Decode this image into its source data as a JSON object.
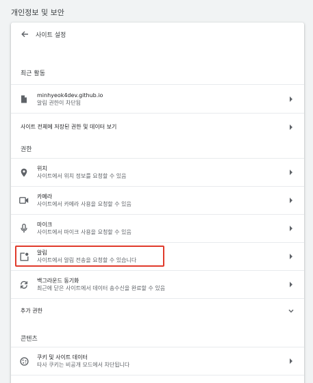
{
  "page": {
    "section_title": "개인정보 및 보안",
    "header_title": "사이트 설정"
  },
  "recent": {
    "label": "최근 활동",
    "site": {
      "domain": "minhyeok4dev.github.io",
      "status": "알림 권한이 차단됨"
    }
  },
  "all_sites": {
    "label": "사이트 전체에 저장된 권한 및 데이터 보기"
  },
  "permissions": {
    "label": "권한",
    "items": [
      {
        "icon": "location-pin-icon",
        "title": "위치",
        "desc": "사이트에서 위치 정보를 요청할 수 있음"
      },
      {
        "icon": "camera-icon",
        "title": "카메라",
        "desc": "사이트에서 카메라 사용을 요청할 수 있음"
      },
      {
        "icon": "microphone-icon",
        "title": "마이크",
        "desc": "사이트에서 마이크 사용을 요청할 수 있음"
      },
      {
        "icon": "notification-icon",
        "title": "알림",
        "desc": "사이트에서 알림 전송을 요청할 수 있습니다"
      },
      {
        "icon": "sync-icon",
        "title": "백그라운드 동기화",
        "desc": "최근에 닫은 사이트에서 데이터 송수신을 완료할 수 있음"
      }
    ]
  },
  "additional": {
    "label": "추가 권한"
  },
  "content": {
    "label": "콘텐츠",
    "items": [
      {
        "icon": "cookie-icon",
        "title": "쿠키 및 사이트 데이터",
        "desc": "타사 쿠키는 비공개 모드에서 차단됩니다"
      }
    ]
  },
  "colors": {
    "highlight": "#e0392a",
    "icon": "#5f6368"
  }
}
